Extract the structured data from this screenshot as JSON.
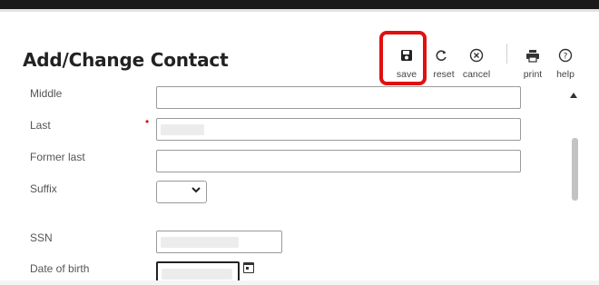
{
  "page": {
    "title": "Add/Change Contact"
  },
  "toolbar": {
    "items": [
      {
        "label": "save",
        "icon": "save-icon"
      },
      {
        "label": "reset",
        "icon": "reset-icon"
      },
      {
        "label": "cancel",
        "icon": "cancel-icon"
      },
      {
        "label": "print",
        "icon": "print-icon"
      },
      {
        "label": "help",
        "icon": "help-icon"
      }
    ],
    "highlight_color": "#e01010"
  },
  "form": {
    "fields": [
      {
        "label": "Middle",
        "required": false,
        "value": ""
      },
      {
        "label": "Last",
        "required": true,
        "value": ""
      },
      {
        "label": "Former last",
        "required": false,
        "value": ""
      },
      {
        "label": "Suffix",
        "required": false,
        "value": ""
      },
      {
        "label": "SSN",
        "required": false,
        "value": ""
      },
      {
        "label": "Date of birth",
        "required": false,
        "value": ""
      }
    ],
    "required_marker": "•"
  }
}
